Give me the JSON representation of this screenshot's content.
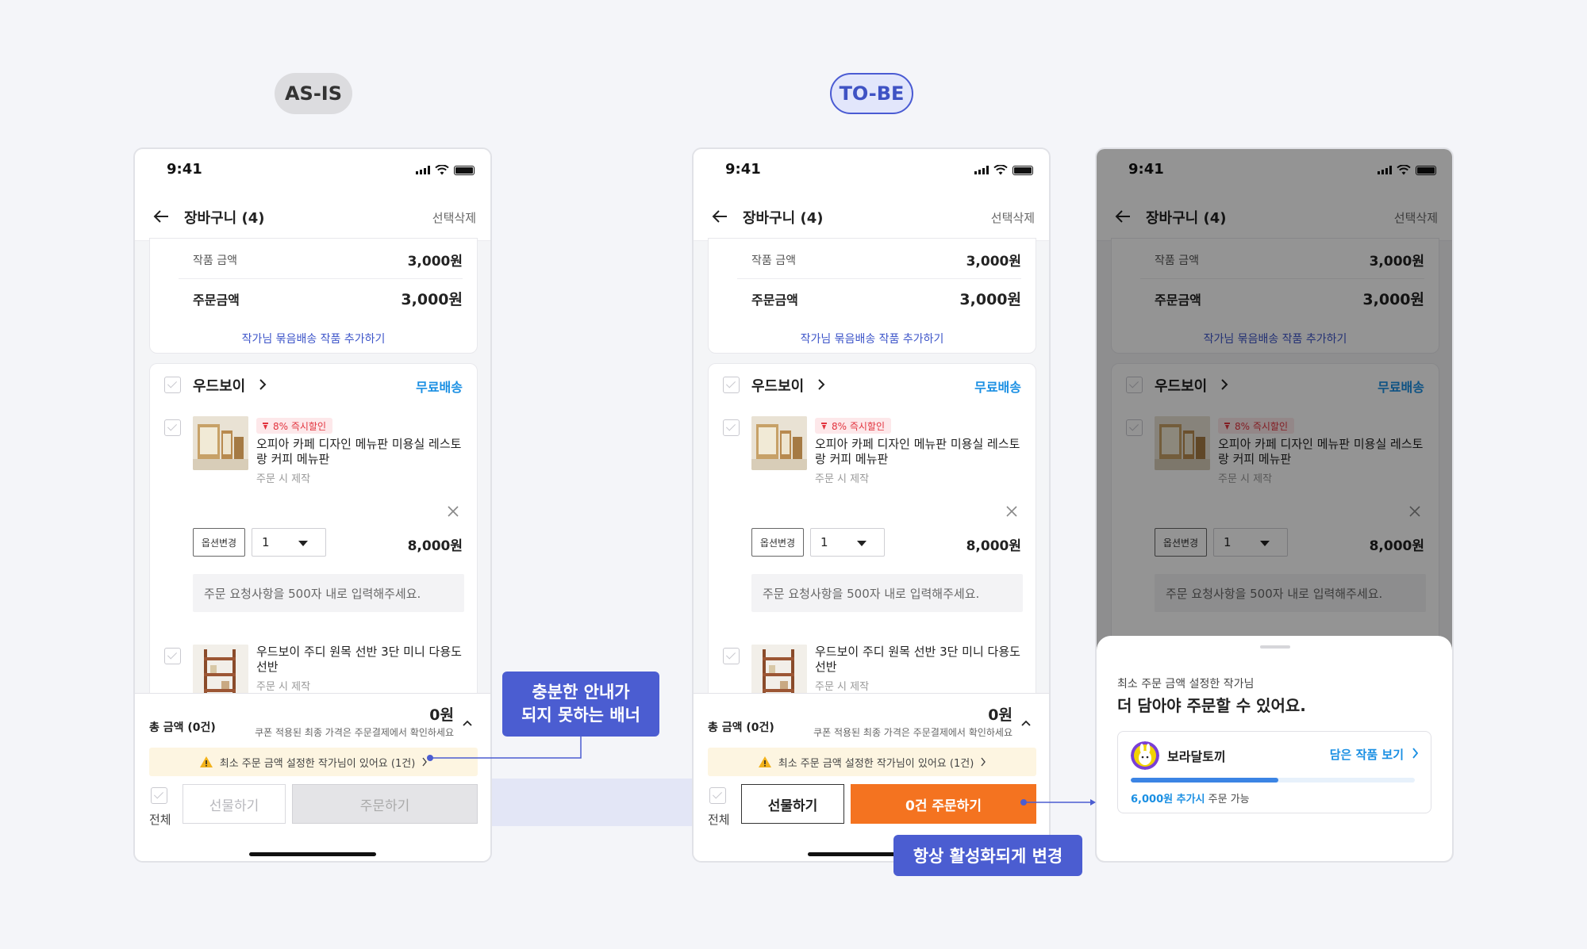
{
  "labels": {
    "as_is": "AS-IS",
    "to_be": "TO-BE"
  },
  "status": {
    "time": "9:41"
  },
  "nav": {
    "title": "장바구니 (4)",
    "action": "선택삭제"
  },
  "summary": {
    "work_amount_label": "작품 금액",
    "work_amount_value": "3,000원",
    "order_amount_label": "주문금액",
    "order_amount_value": "3,000원",
    "bundle_link": "작가님 묶음배송 작품 추가하기"
  },
  "shop": {
    "name": "우드보이",
    "shipping": "무료배송"
  },
  "items": [
    {
      "badge": "8% 즉시할인",
      "title": "오피아 카페 디자인 메뉴판 미용실 레스토랑 커피 메뉴판",
      "sub": "주문 시 제작",
      "option_button": "옵션변경",
      "qty": "1",
      "price": "8,000원",
      "request_placeholder": "주문 요청사항을 500자 내로 입력해주세요."
    },
    {
      "title": "우드보이 주디 원목 선반 3단 미니 다용도 선반",
      "sub": "주문 시 제작"
    }
  ],
  "footer": {
    "total_label": "총 금액 (0건)",
    "total_value": "0원",
    "total_note": "쿠폰 적용된 최종 가격은 주문결제에서 확인하세요",
    "warning": "최소 주문 금액 설정한 작가님이 있어요 (1건)",
    "all_label": "전체",
    "gift": "선물하기",
    "order_asis": "주문하기",
    "order_tobe": "0건 주문하기"
  },
  "sheet": {
    "subtitle": "최소 주문 금액 설정한 작가님",
    "title": "더 담아야 주문할 수 있어요.",
    "artist": "보라달토끼",
    "view_link": "담은 작품 보기",
    "progress_amount": "6,000원 추가시",
    "progress_suffix": " 주문 가능",
    "progress_fraction": 0.52
  },
  "callouts": {
    "banner_issue": "충분한 안내가\n되지 못하는 배너",
    "always_active": "항상 활성화되게 변경"
  },
  "colors": {
    "accent": "#4b5dd1",
    "order": "#f47320",
    "link": "#1a8fe3",
    "discount": "#e2343f"
  }
}
